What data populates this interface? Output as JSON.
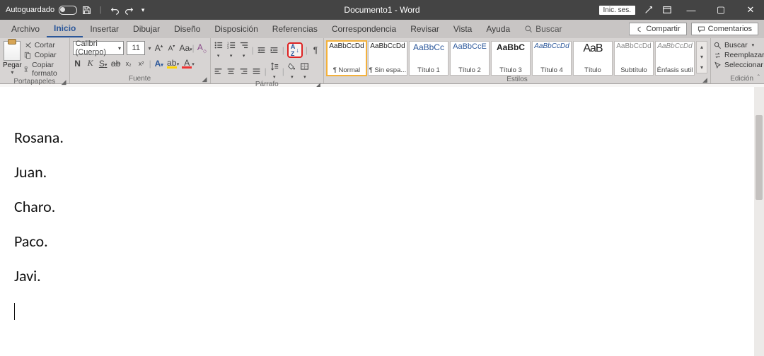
{
  "titlebar": {
    "autoguardado": "Autoguardado",
    "doc_title": "Documento1  -  Word",
    "login": "Inic. ses."
  },
  "menubar": {
    "tabs": [
      "Archivo",
      "Inicio",
      "Insertar",
      "Dibujar",
      "Diseño",
      "Disposición",
      "Referencias",
      "Correspondencia",
      "Revisar",
      "Vista",
      "Ayuda"
    ],
    "active_index": 1,
    "search_label": "Buscar",
    "share_label": "Compartir",
    "comments_label": "Comentarios"
  },
  "ribbon": {
    "clipboard": {
      "paste": "Pegar",
      "cut": "Cortar",
      "copy": "Copiar",
      "format_painter": "Copiar formato",
      "group_label": "Portapapeles"
    },
    "font": {
      "font_name": "Calibri (Cuerpo)",
      "font_size": "11",
      "group_label": "Fuente"
    },
    "paragraph": {
      "group_label": "Párrafo"
    },
    "styles": {
      "group_label": "Estilos",
      "items": [
        {
          "preview": "AaBbCcDd",
          "label": "¶ Normal",
          "variant": "sel"
        },
        {
          "preview": "AaBbCcDd",
          "label": "¶ Sin espa...",
          "variant": ""
        },
        {
          "preview": "AaBbCc",
          "label": "Título 1",
          "variant": "t1"
        },
        {
          "preview": "AaBbCcE",
          "label": "Título 2",
          "variant": "t2"
        },
        {
          "preview": "AaBbC",
          "label": "Título 3",
          "variant": "t3"
        },
        {
          "preview": "AaBbCcDd",
          "label": "Título 4",
          "variant": "t4"
        },
        {
          "preview": "AaB",
          "label": "Título",
          "variant": "tit"
        },
        {
          "preview": "AaBbCcDd",
          "label": "Subtítulo",
          "variant": "sub"
        },
        {
          "preview": "AaBbCcDd",
          "label": "Énfasis sutil",
          "variant": "enf"
        }
      ]
    },
    "editing": {
      "find": "Buscar",
      "replace": "Reemplazar",
      "select": "Seleccionar",
      "group_label": "Edición"
    }
  },
  "document": {
    "lines": [
      "Rosana.",
      "Juan.",
      "Charo.",
      "Paco.",
      "Javi."
    ]
  }
}
